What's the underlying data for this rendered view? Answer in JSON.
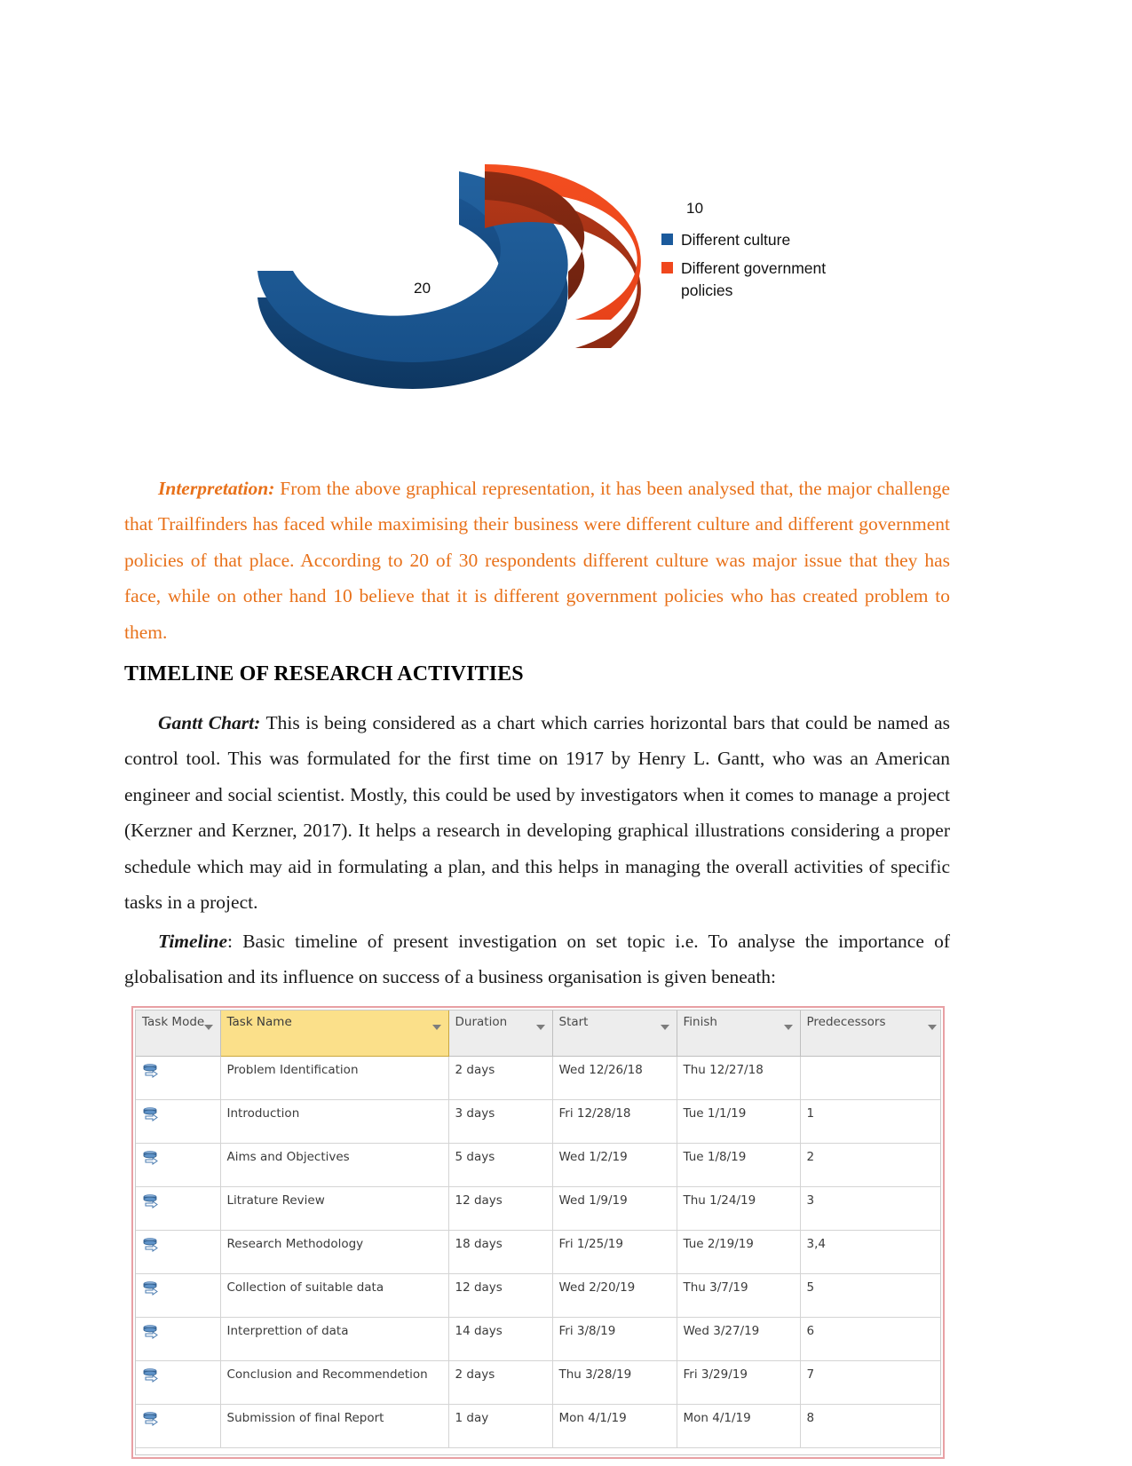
{
  "chart": {
    "labels": {
      "blue": "20",
      "orange": "10"
    },
    "legend": [
      {
        "name": "Different culture",
        "color": "#1B5A9C"
      },
      {
        "name": "Different government policies",
        "color": "#F0471D"
      }
    ]
  },
  "chart_data": {
    "type": "pie",
    "title": "",
    "subtitle": "",
    "variant": "3d-doughnut-exploded",
    "categories": [
      "Different culture",
      "Different government policies"
    ],
    "values": [
      20,
      10
    ],
    "total": 30,
    "data_labels": [
      "20",
      "10"
    ],
    "colors": [
      "#1B5A9C",
      "#F0471D"
    ],
    "side_colors": [
      "#123E6E",
      "#A8311A"
    ],
    "legend_position": "right",
    "grid": false,
    "xlabel": "",
    "ylabel": ""
  },
  "interpretation": {
    "lead": "Interpretation:",
    "body": " From the above graphical representation, it has been analysed that, the major challenge that Trailfinders has faced while maximising their business were different culture and different government policies of that place. According to 20 of 30 respondents different culture was major issue that they has face, while on other hand 10 believe that it is different government policies who has created problem to them."
  },
  "heading": "TIMELINE OF RESEARCH ACTIVITIES",
  "gantt_para": {
    "lead": "Gantt Chart:",
    "body": " This is being considered as a chart which carries horizontal bars that could be named as control tool. This was formulated for the first time on 1917 by Henry L. Gantt, who was an American engineer and social scientist. Mostly, this could be used by investigators when it comes to manage a project (Kerzner and Kerzner, 2017). It helps a research in developing graphical illustrations considering a proper schedule which may aid in formulating a plan, and this helps in managing the overall activities of specific tasks in a project."
  },
  "timeline_para": {
    "lead": "Timeline",
    "body": ": Basic timeline of present investigation on set topic i.e. To analyse the importance of globalisation and its influence on success of a business organisation is given beneath:"
  },
  "gantt_table": {
    "columns": [
      "Task Mode",
      "Task Name",
      "Duration",
      "Start",
      "Finish",
      "Predecessors"
    ],
    "rows": [
      {
        "name": "Problem Identification",
        "duration": "2 days",
        "start": "Wed 12/26/18",
        "finish": "Thu 12/27/18",
        "predecessors": ""
      },
      {
        "name": "Introduction",
        "duration": "3 days",
        "start": "Fri 12/28/18",
        "finish": "Tue 1/1/19",
        "predecessors": "1"
      },
      {
        "name": "Aims and Objectives",
        "duration": "5 days",
        "start": "Wed 1/2/19",
        "finish": "Tue 1/8/19",
        "predecessors": "2"
      },
      {
        "name": "Litrature Review",
        "duration": "12 days",
        "start": "Wed 1/9/19",
        "finish": "Thu 1/24/19",
        "predecessors": "3"
      },
      {
        "name": "Research Methodology",
        "duration": "18 days",
        "start": "Fri 1/25/19",
        "finish": "Tue 2/19/19",
        "predecessors": "3,4"
      },
      {
        "name": "Collection of suitable data",
        "duration": "12 days",
        "start": "Wed 2/20/19",
        "finish": "Thu 3/7/19",
        "predecessors": "5"
      },
      {
        "name": "Interprettion of data",
        "duration": "14 days",
        "start": "Fri 3/8/19",
        "finish": "Wed 3/27/19",
        "predecessors": "6"
      },
      {
        "name": "Conclusion  and Recommendetion",
        "duration": "2 days",
        "start": "Thu 3/28/19",
        "finish": "Fri 3/29/19",
        "predecessors": "7"
      },
      {
        "name": "Submission of final Report",
        "duration": "1 day",
        "start": "Mon 4/1/19",
        "finish": "Mon 4/1/19",
        "predecessors": "8"
      }
    ]
  }
}
